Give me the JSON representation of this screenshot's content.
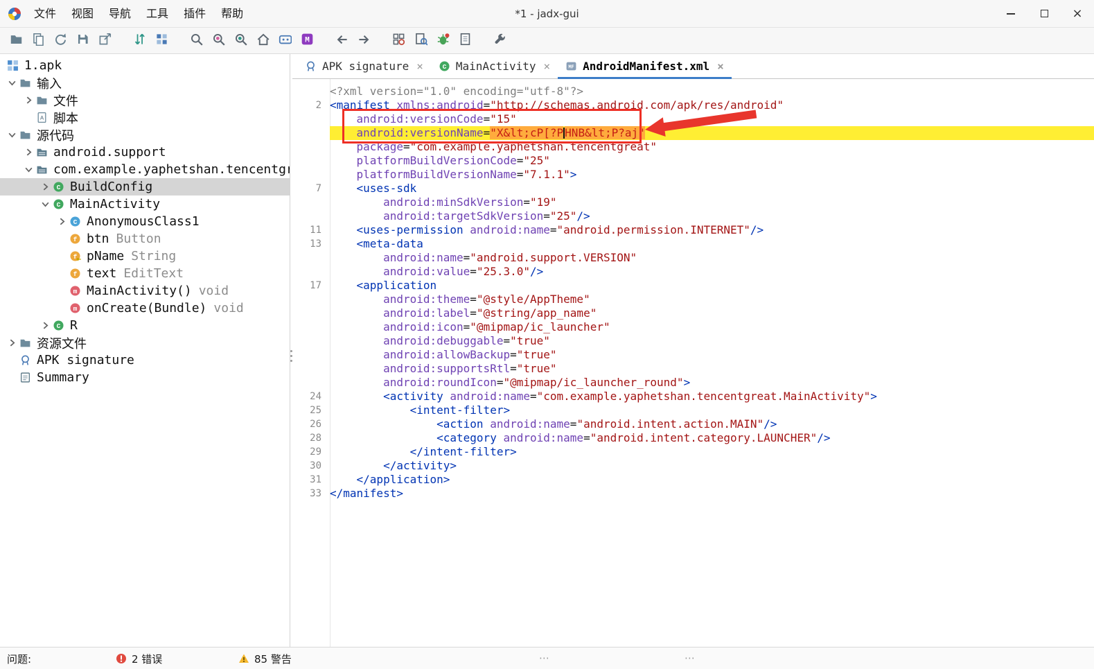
{
  "window": {
    "title": "*1 - jadx-gui",
    "logo_icon": "jadx-logo-icon"
  },
  "menu": {
    "items": [
      "文件",
      "视图",
      "导航",
      "工具",
      "插件",
      "帮助"
    ]
  },
  "toolbar": {
    "items": [
      "open-file-icon",
      "add-files-icon",
      "reload-icon",
      "save-all-icon",
      "export-icon",
      "gap",
      "sync-icon",
      "flat-packages-icon",
      "gap",
      "text-search-icon",
      "class-search-icon",
      "comment-search-icon",
      "main-activity-icon",
      "adb-icon",
      "mappings-icon",
      "gap",
      "back-icon",
      "forward-icon",
      "gap",
      "deobfuscation-icon",
      "quark-icon",
      "debugger-icon",
      "log-viewer-icon",
      "gap",
      "preferences-icon"
    ]
  },
  "tabs": {
    "close_glyph": "×",
    "items": [
      {
        "label": "APK signature",
        "icon": "signature-icon",
        "active": false
      },
      {
        "label": "MainActivity",
        "icon": "class-icon",
        "active": false
      },
      {
        "label": "AndroidManifest.xml",
        "icon": "manifest-file-icon",
        "active": true
      }
    ]
  },
  "tree": {
    "items": [
      {
        "indent": 0,
        "slot": false,
        "chevron": "none",
        "icon": "apk-icon",
        "label": "1.apk",
        "suffix": "",
        "selected": false
      },
      {
        "indent": 0,
        "slot": true,
        "chevron": "down",
        "icon": "input-folder-icon",
        "label": "输入",
        "suffix": "",
        "selected": false
      },
      {
        "indent": 1,
        "slot": true,
        "chevron": "right",
        "icon": "folder-icon",
        "label": "文件",
        "suffix": "",
        "selected": false
      },
      {
        "indent": 1,
        "slot": true,
        "chevron": "none",
        "icon": "script-icon",
        "label": "脚本",
        "suffix": "",
        "selected": false
      },
      {
        "indent": 0,
        "slot": true,
        "chevron": "down",
        "icon": "source-folder-icon",
        "label": "源代码",
        "suffix": "",
        "selected": false
      },
      {
        "indent": 1,
        "slot": true,
        "chevron": "right",
        "icon": "package-icon",
        "label": "android.support",
        "suffix": "",
        "selected": false
      },
      {
        "indent": 1,
        "slot": true,
        "chevron": "down",
        "icon": "package-icon",
        "label": "com.example.yaphetshan.tencentgreat",
        "suffix": "",
        "selected": false
      },
      {
        "indent": 2,
        "slot": true,
        "chevron": "right",
        "icon": "class-icon",
        "label": "BuildConfig",
        "suffix": "",
        "selected": true
      },
      {
        "indent": 2,
        "slot": true,
        "chevron": "down",
        "icon": "class-icon",
        "label": "MainActivity",
        "suffix": "",
        "selected": false
      },
      {
        "indent": 3,
        "slot": true,
        "chevron": "right",
        "icon": "class-blue-icon",
        "label": "AnonymousClass1",
        "suffix": "",
        "selected": false
      },
      {
        "indent": 3,
        "slot": true,
        "chevron": "none",
        "icon": "field-icon",
        "label": "btn",
        "suffix": "Button",
        "selected": false
      },
      {
        "indent": 3,
        "slot": true,
        "chevron": "none",
        "icon": "field-key-icon",
        "label": "pName",
        "suffix": "String",
        "selected": false
      },
      {
        "indent": 3,
        "slot": true,
        "chevron": "none",
        "icon": "field-icon",
        "label": "text",
        "suffix": "EditText",
        "selected": false
      },
      {
        "indent": 3,
        "slot": true,
        "chevron": "none",
        "icon": "method-icon",
        "label": "MainActivity()",
        "suffix": "void",
        "selected": false
      },
      {
        "indent": 3,
        "slot": true,
        "chevron": "none",
        "icon": "method-icon",
        "label": "onCreate(Bundle)",
        "suffix": "void",
        "selected": false
      },
      {
        "indent": 2,
        "slot": true,
        "chevron": "right",
        "icon": "class-icon",
        "label": "R",
        "suffix": "",
        "selected": false
      },
      {
        "indent": 0,
        "slot": true,
        "chevron": "right",
        "icon": "res-folder-icon",
        "label": "资源文件",
        "suffix": "",
        "selected": false
      },
      {
        "indent": 0,
        "slot": true,
        "chevron": "none",
        "icon": "signature-icon",
        "label": "APK signature",
        "suffix": "",
        "selected": false
      },
      {
        "indent": 0,
        "slot": true,
        "chevron": "none",
        "icon": "summary-icon",
        "label": "Summary",
        "suffix": "",
        "selected": false
      }
    ]
  },
  "editor": {
    "lines": [
      {
        "n": "",
        "s": [
          [
            "g",
            "<?xml version=\"1.0\" encoding=\"utf-8\"?>"
          ]
        ]
      },
      {
        "n": "2",
        "s": [
          [
            "t",
            "<manifest"
          ],
          [
            "p",
            " "
          ],
          [
            "a",
            "xmlns:android"
          ],
          [
            "p",
            "="
          ],
          [
            "v",
            "\"http://schemas.android.com/apk/res/android\""
          ]
        ]
      },
      {
        "n": "",
        "s": [
          [
            "p",
            "    "
          ],
          [
            "a",
            "android:versionCode"
          ],
          [
            "p",
            "="
          ],
          [
            "v",
            "\"15\""
          ]
        ]
      },
      {
        "n": "",
        "hl": true,
        "s": [
          [
            "p",
            "    "
          ],
          [
            "a",
            "android:versionName"
          ],
          [
            "p",
            "="
          ],
          [
            "hv",
            "\"X&lt;cP[?P"
          ],
          [
            "caret",
            ""
          ],
          [
            "hv",
            "HNB&lt;P?aj\""
          ]
        ]
      },
      {
        "n": "",
        "s": [
          [
            "p",
            "    "
          ],
          [
            "a",
            "package"
          ],
          [
            "p",
            "="
          ],
          [
            "v",
            "\"com.example.yaphetshan.tencentgreat\""
          ]
        ]
      },
      {
        "n": "",
        "s": [
          [
            "p",
            "    "
          ],
          [
            "a",
            "platformBuildVersionCode"
          ],
          [
            "p",
            "="
          ],
          [
            "v",
            "\"25\""
          ]
        ]
      },
      {
        "n": "",
        "s": [
          [
            "p",
            "    "
          ],
          [
            "a",
            "platformBuildVersionName"
          ],
          [
            "p",
            "="
          ],
          [
            "v",
            "\"7.1.1\""
          ],
          [
            "t",
            ">"
          ]
        ]
      },
      {
        "n": "7",
        "s": [
          [
            "p",
            "    "
          ],
          [
            "t",
            "<uses-sdk"
          ]
        ]
      },
      {
        "n": "",
        "s": [
          [
            "p",
            "        "
          ],
          [
            "a",
            "android:minSdkVersion"
          ],
          [
            "p",
            "="
          ],
          [
            "v",
            "\"19\""
          ]
        ]
      },
      {
        "n": "",
        "s": [
          [
            "p",
            "        "
          ],
          [
            "a",
            "android:targetSdkVersion"
          ],
          [
            "p",
            "="
          ],
          [
            "v",
            "\"25\""
          ],
          [
            "t",
            "/>"
          ]
        ]
      },
      {
        "n": "11",
        "s": [
          [
            "p",
            "    "
          ],
          [
            "t",
            "<uses-permission"
          ],
          [
            "p",
            " "
          ],
          [
            "a",
            "android:name"
          ],
          [
            "p",
            "="
          ],
          [
            "v",
            "\"android.permission.INTERNET\""
          ],
          [
            "t",
            "/>"
          ]
        ]
      },
      {
        "n": "13",
        "s": [
          [
            "p",
            "    "
          ],
          [
            "t",
            "<meta-data"
          ]
        ]
      },
      {
        "n": "",
        "s": [
          [
            "p",
            "        "
          ],
          [
            "a",
            "android:name"
          ],
          [
            "p",
            "="
          ],
          [
            "v",
            "\"android.support.VERSION\""
          ]
        ]
      },
      {
        "n": "",
        "s": [
          [
            "p",
            "        "
          ],
          [
            "a",
            "android:value"
          ],
          [
            "p",
            "="
          ],
          [
            "v",
            "\"25.3.0\""
          ],
          [
            "t",
            "/>"
          ]
        ]
      },
      {
        "n": "17",
        "s": [
          [
            "p",
            "    "
          ],
          [
            "t",
            "<application"
          ]
        ]
      },
      {
        "n": "",
        "s": [
          [
            "p",
            "        "
          ],
          [
            "a",
            "android:theme"
          ],
          [
            "p",
            "="
          ],
          [
            "v",
            "\"@style/AppTheme\""
          ]
        ]
      },
      {
        "n": "",
        "s": [
          [
            "p",
            "        "
          ],
          [
            "a",
            "android:label"
          ],
          [
            "p",
            "="
          ],
          [
            "v",
            "\"@string/app_name\""
          ]
        ]
      },
      {
        "n": "",
        "s": [
          [
            "p",
            "        "
          ],
          [
            "a",
            "android:icon"
          ],
          [
            "p",
            "="
          ],
          [
            "v",
            "\"@mipmap/ic_launcher\""
          ]
        ]
      },
      {
        "n": "",
        "s": [
          [
            "p",
            "        "
          ],
          [
            "a",
            "android:debuggable"
          ],
          [
            "p",
            "="
          ],
          [
            "v",
            "\"true\""
          ]
        ]
      },
      {
        "n": "",
        "s": [
          [
            "p",
            "        "
          ],
          [
            "a",
            "android:allowBackup"
          ],
          [
            "p",
            "="
          ],
          [
            "v",
            "\"true\""
          ]
        ]
      },
      {
        "n": "",
        "s": [
          [
            "p",
            "        "
          ],
          [
            "a",
            "android:supportsRtl"
          ],
          [
            "p",
            "="
          ],
          [
            "v",
            "\"true\""
          ]
        ]
      },
      {
        "n": "",
        "s": [
          [
            "p",
            "        "
          ],
          [
            "a",
            "android:roundIcon"
          ],
          [
            "p",
            "="
          ],
          [
            "v",
            "\"@mipmap/ic_launcher_round\""
          ],
          [
            "t",
            ">"
          ]
        ]
      },
      {
        "n": "24",
        "s": [
          [
            "p",
            "        "
          ],
          [
            "t",
            "<activity"
          ],
          [
            "p",
            " "
          ],
          [
            "a",
            "android:name"
          ],
          [
            "p",
            "="
          ],
          [
            "v",
            "\"com.example.yaphetshan.tencentgreat.MainActivity\""
          ],
          [
            "t",
            ">"
          ]
        ]
      },
      {
        "n": "25",
        "s": [
          [
            "p",
            "            "
          ],
          [
            "t",
            "<intent-filter>"
          ]
        ]
      },
      {
        "n": "26",
        "s": [
          [
            "p",
            "                "
          ],
          [
            "t",
            "<action"
          ],
          [
            "p",
            " "
          ],
          [
            "a",
            "android:name"
          ],
          [
            "p",
            "="
          ],
          [
            "v",
            "\"android.intent.action.MAIN\""
          ],
          [
            "t",
            "/>"
          ]
        ]
      },
      {
        "n": "28",
        "s": [
          [
            "p",
            "                "
          ],
          [
            "t",
            "<category"
          ],
          [
            "p",
            " "
          ],
          [
            "a",
            "android:name"
          ],
          [
            "p",
            "="
          ],
          [
            "v",
            "\"android.intent.category.LAUNCHER\""
          ],
          [
            "t",
            "/>"
          ]
        ]
      },
      {
        "n": "29",
        "s": [
          [
            "p",
            "            "
          ],
          [
            "t",
            "</intent-filter>"
          ]
        ]
      },
      {
        "n": "30",
        "s": [
          [
            "p",
            "        "
          ],
          [
            "t",
            "</activity>"
          ]
        ]
      },
      {
        "n": "31",
        "s": [
          [
            "p",
            "    "
          ],
          [
            "t",
            "</application>"
          ]
        ]
      },
      {
        "n": "33",
        "s": [
          [
            "t",
            "</manifest>"
          ]
        ]
      }
    ]
  },
  "statusbar": {
    "problems_label": "问题:",
    "errors_text": "2 错误",
    "warnings_text": "85 警告",
    "error_icon": "error-icon",
    "warning_icon": "warning-icon"
  },
  "colors": {
    "accent_blue": "#3d7dc8",
    "tag": "#0033b3",
    "attribute": "#6f42b3",
    "value": "#a31515",
    "line_highlight": "#ffee33",
    "selection_orange": "#ffab3d",
    "annotation_red": "#ee2f25",
    "error_red": "#e04a3f",
    "warning_yellow": "#f5b82e"
  }
}
